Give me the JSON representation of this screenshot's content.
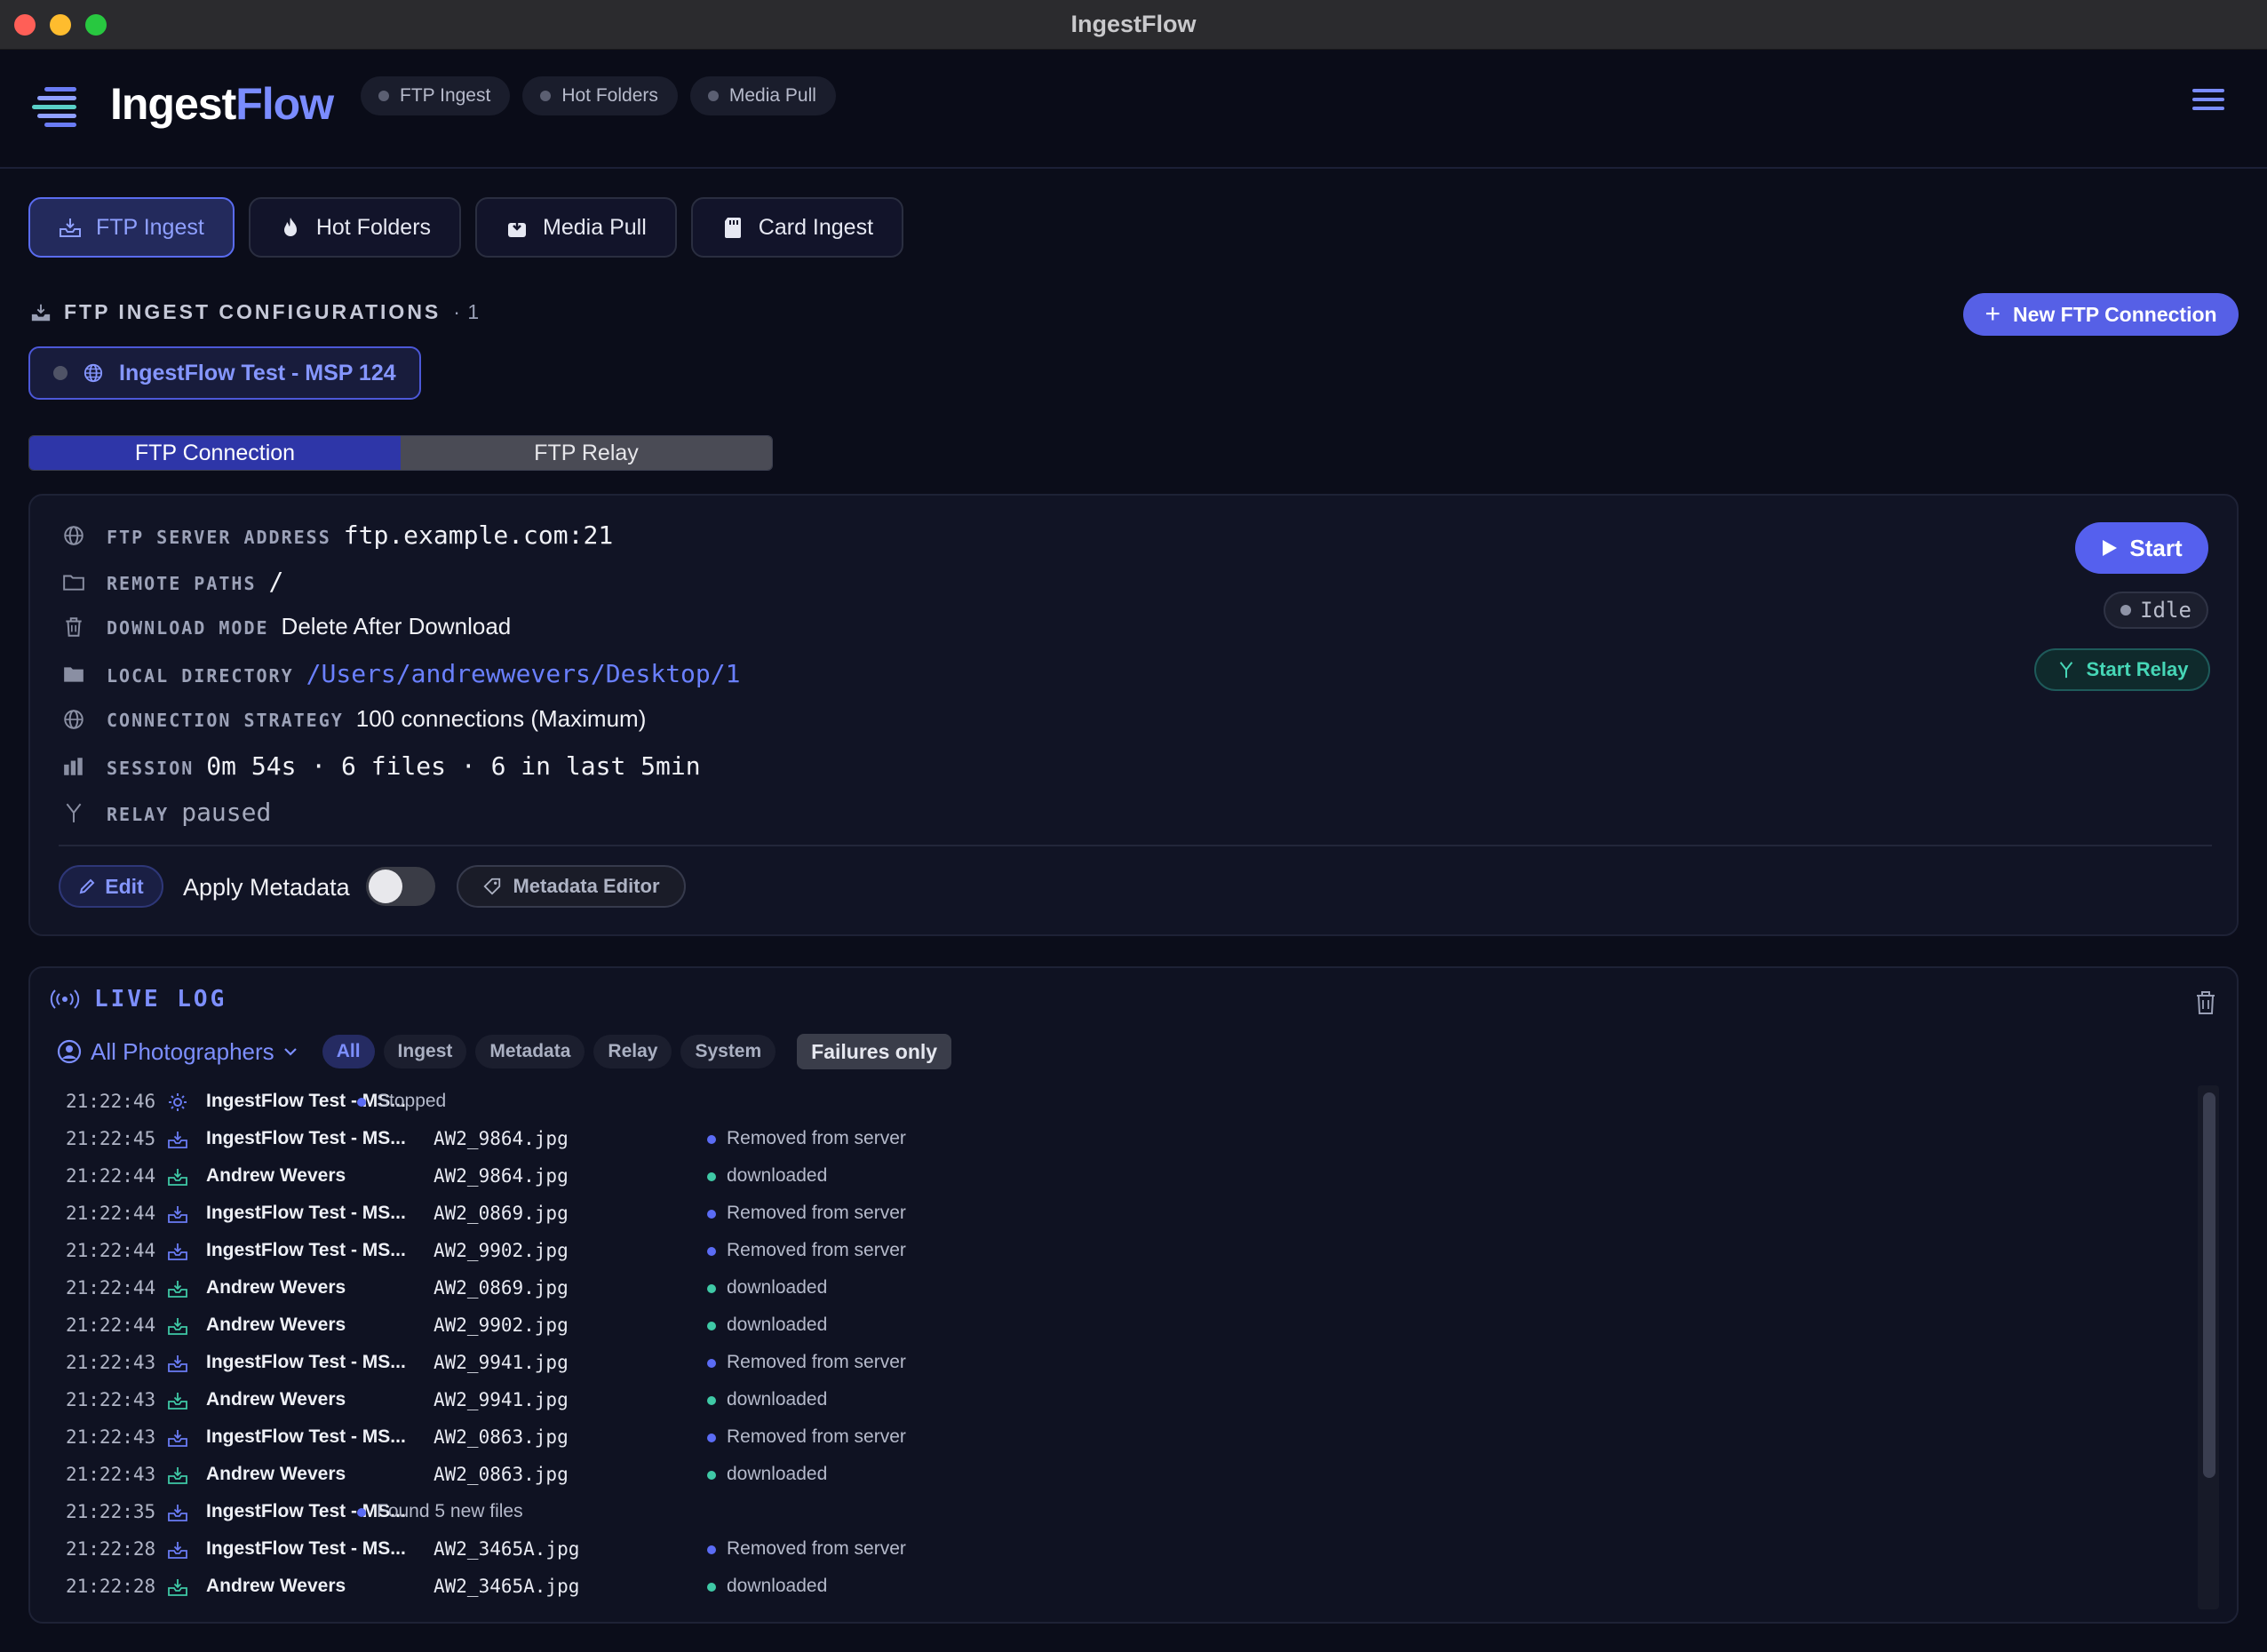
{
  "window": {
    "title": "IngestFlow"
  },
  "header": {
    "brand_part1": "Ingest",
    "brand_part2": "Flow",
    "status_pills": [
      "FTP Ingest",
      "Hot Folders",
      "Media Pull"
    ]
  },
  "main_tabs": [
    "FTP Ingest",
    "Hot Folders",
    "Media Pull",
    "Card Ingest"
  ],
  "section": {
    "title": "FTP INGEST CONFIGURATIONS",
    "count": "· 1",
    "new_button": "New FTP Connection"
  },
  "config_chip": "IngestFlow Test - MSP 124",
  "segment": {
    "tab1": "FTP Connection",
    "tab2": "FTP Relay"
  },
  "details": {
    "server_label": "FTP SERVER ADDRESS",
    "server_value": "ftp.example.com:21",
    "paths_label": "REMOTE PATHS",
    "paths_value": "/",
    "mode_label": "DOWNLOAD MODE",
    "mode_value": "Delete After Download",
    "local_label": "LOCAL DIRECTORY",
    "local_value": "/Users/andrewwevers/Desktop/1",
    "strategy_label": "CONNECTION STRATEGY",
    "strategy_value": "100 connections (Maximum)",
    "session_label": "SESSION",
    "session_value": "0m 54s · 6 files · 6 in last 5min",
    "relay_label": "RELAY",
    "relay_value": "paused"
  },
  "actions": {
    "start": "Start",
    "status": "Idle",
    "start_relay": "Start Relay",
    "edit": "Edit",
    "apply_metadata": "Apply Metadata",
    "apply_metadata_on": false,
    "metadata_editor": "Metadata Editor"
  },
  "log": {
    "title": "LIVE LOG",
    "photographer_filter": "All Photographers",
    "filters": [
      "All",
      "Ingest",
      "Metadata",
      "Relay",
      "System"
    ],
    "failures_only": "Failures only",
    "colors": {
      "blue": "#5b6cf5",
      "green": "#3fc9a6"
    },
    "rows": [
      {
        "time": "21:22:46",
        "icon": "gear-icon",
        "source": "IngestFlow Test - MS...",
        "file": "",
        "message": "Stopped",
        "dot": "blue"
      },
      {
        "time": "21:22:45",
        "icon": "inbox-icon",
        "source": "IngestFlow Test - MS...",
        "file": "AW2_9864.jpg",
        "message": "Removed from server",
        "dot": "blue"
      },
      {
        "time": "21:22:44",
        "icon": "inbox-icon",
        "source": "Andrew Wevers",
        "file": "AW2_9864.jpg",
        "message": "downloaded",
        "dot": "green"
      },
      {
        "time": "21:22:44",
        "icon": "inbox-icon",
        "source": "IngestFlow Test - MS...",
        "file": "AW2_0869.jpg",
        "message": "Removed from server",
        "dot": "blue"
      },
      {
        "time": "21:22:44",
        "icon": "inbox-icon",
        "source": "IngestFlow Test - MS...",
        "file": "AW2_9902.jpg",
        "message": "Removed from server",
        "dot": "blue"
      },
      {
        "time": "21:22:44",
        "icon": "inbox-icon",
        "source": "Andrew Wevers",
        "file": "AW2_0869.jpg",
        "message": "downloaded",
        "dot": "green"
      },
      {
        "time": "21:22:44",
        "icon": "inbox-icon",
        "source": "Andrew Wevers",
        "file": "AW2_9902.jpg",
        "message": "downloaded",
        "dot": "green"
      },
      {
        "time": "21:22:43",
        "icon": "inbox-icon",
        "source": "IngestFlow Test - MS...",
        "file": "AW2_9941.jpg",
        "message": "Removed from server",
        "dot": "blue"
      },
      {
        "time": "21:22:43",
        "icon": "inbox-icon",
        "source": "Andrew Wevers",
        "file": "AW2_9941.jpg",
        "message": "downloaded",
        "dot": "green"
      },
      {
        "time": "21:22:43",
        "icon": "inbox-icon",
        "source": "IngestFlow Test - MS...",
        "file": "AW2_0863.jpg",
        "message": "Removed from server",
        "dot": "blue"
      },
      {
        "time": "21:22:43",
        "icon": "inbox-icon",
        "source": "Andrew Wevers",
        "file": "AW2_0863.jpg",
        "message": "downloaded",
        "dot": "green"
      },
      {
        "time": "21:22:35",
        "icon": "inbox-icon",
        "source": "IngestFlow Test - MS...",
        "file": "",
        "message": "Found 5 new files",
        "dot": "blue"
      },
      {
        "time": "21:22:28",
        "icon": "inbox-icon",
        "source": "IngestFlow Test - MS...",
        "file": "AW2_3465A.jpg",
        "message": "Removed from server",
        "dot": "blue"
      },
      {
        "time": "21:22:28",
        "icon": "inbox-icon",
        "source": "Andrew Wevers",
        "file": "AW2_3465A.jpg",
        "message": "downloaded",
        "dot": "green"
      }
    ]
  }
}
